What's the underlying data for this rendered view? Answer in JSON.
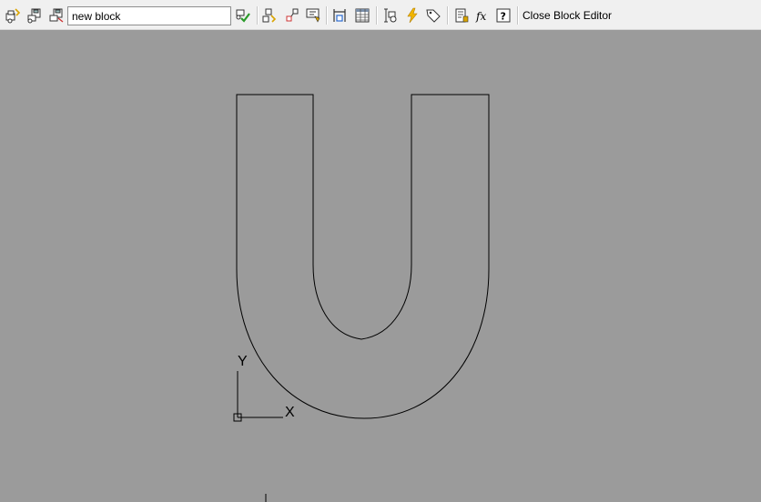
{
  "toolbar": {
    "block_name_value": "new block",
    "close_label": "Close Block Editor",
    "icons": [
      "edit-block-icon",
      "save-block-icon",
      "save-block-as-icon",
      "validate-block-icon",
      "authoring-palettes-icon",
      "parameter-icon",
      "action-icon",
      "constraint-icon",
      "block-table-icon",
      "test-block-icon",
      "action-bar-icon",
      "attribute-definition-icon",
      "parameters-manager-icon",
      "function-icon",
      "help-icon"
    ]
  },
  "canvas": {
    "ucs": {
      "x_label": "X",
      "y_label": "Y"
    },
    "colors": {
      "background": "#9b9b9b",
      "stroke": "#000000"
    }
  }
}
